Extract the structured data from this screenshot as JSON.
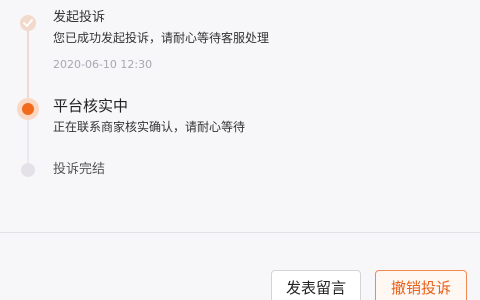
{
  "steps": [
    {
      "title": "发起投诉",
      "desc": "您已成功发起投诉，请耐心等待客服处理",
      "time": "2020-06-10 12:30",
      "status": "done",
      "icon": "check-icon"
    },
    {
      "title": "平台核实中",
      "desc": "正在联系商家核实确认，请耐心等待",
      "status": "current"
    },
    {
      "title": "投诉完结",
      "status": "pending"
    }
  ],
  "actions": {
    "leave_message": "发表留言",
    "cancel_complaint": "撤销投诉"
  },
  "colors": {
    "accent": "#f26a1b",
    "done_dot": "#f1d9cb",
    "pending_dot": "#e4e1e8"
  }
}
